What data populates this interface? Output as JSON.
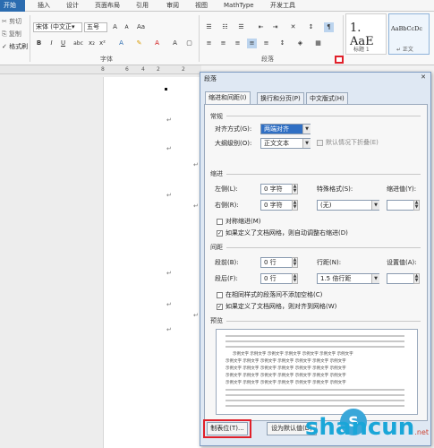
{
  "ribbon_tabs": [
    "开始",
    "插入",
    "设计",
    "页面布局",
    "引用",
    "审阅",
    "视图",
    "MathType",
    "开发工具"
  ],
  "clipboard": {
    "cut": "剪切",
    "copy": "复制",
    "format_painter": "格式刷"
  },
  "font": {
    "name": "宋体 (中文正▾",
    "size": "五号",
    "group_label": "字体"
  },
  "paragraph": {
    "group_label": "段落"
  },
  "styles": {
    "heading1_preview": "1. AaE",
    "heading1_name": "标题 1",
    "normal_preview": "AaBbCcDc",
    "normal_name": "↵ 正文"
  },
  "ruler_marks": [
    "8",
    "6",
    "4",
    "2",
    "2"
  ],
  "doc": {
    "para_mark": "↵"
  },
  "dialog": {
    "title": "段落",
    "close": "✕",
    "tabs": [
      "缩进和间距(I)",
      "换行和分页(P)",
      "中文版式(H)"
    ],
    "general_label": "常规",
    "alignment_label": "对齐方式(G):",
    "alignment_value": "两端对齐",
    "outline_label": "大纲级别(O):",
    "outline_value": "正文文本",
    "collapse_label": "默认情况下折叠(E)",
    "indent_label": "缩进",
    "left_label": "左侧(L):",
    "left_value": "0 字符",
    "right_label": "右侧(R):",
    "right_value": "0 字符",
    "special_label": "特殊格式(S):",
    "special_value": "(无)",
    "by_label": "缩进值(Y):",
    "mirror_label": "对称缩进(M)",
    "auto_adjust_label": "如果定义了文档网格，则自动调整右缩进(D)",
    "spacing_label": "间距",
    "before_label": "段前(B):",
    "before_value": "0 行",
    "after_label": "段后(F):",
    "after_value": "0 行",
    "line_spacing_label": "行距(N):",
    "line_spacing_value": "1.5 倍行距",
    "at_label": "设置值(A):",
    "no_space_label": "在相同样式的段落间不添加空格(C)",
    "snap_grid_label": "如果定义了文档网格，则对齐到网格(W)",
    "preview_label": "预览",
    "preview_sample": "示例文字 示例文字 示例文字 示例文字 示例文字 示例文字 示例文字",
    "tabs_button": "制表位(T)...",
    "default_button": "设为默认值(D)"
  },
  "watermark": {
    "text": "shancun",
    "sub": ".net"
  },
  "colors": {
    "accent": "#2b6cb0",
    "highlight": "#e0202a",
    "dialog_bg": "#dfe8f3"
  }
}
